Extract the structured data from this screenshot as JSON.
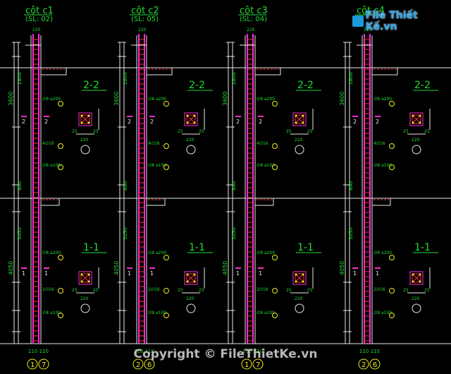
{
  "columns": [
    {
      "name": "cột c1",
      "sl": "(SL: 02)",
      "axis": "1",
      "axis_b": "7",
      "bottom_dims": "110 110"
    },
    {
      "name": "cột c2",
      "sl": "(SL: 05)",
      "axis": "2",
      "axis_b": "6",
      "bottom_dims": "110 110"
    },
    {
      "name": "cột c3",
      "sl": "(SL: 04)",
      "axis": "1",
      "axis_b": "7",
      "bottom_dims": "110 110"
    },
    {
      "name": "cột c4",
      "sl": "",
      "axis": "2",
      "axis_b": "6",
      "bottom_dims": "110 110"
    }
  ],
  "sections": {
    "upper": "2-2",
    "lower": "1-1"
  },
  "dims": {
    "d1": "3600",
    "d2": "4050",
    "d3": "800",
    "d4": "220",
    "d5": "25"
  },
  "rebar_notes": {
    "a": "4∅16",
    "b": "2∅16",
    "c": "∅8 a200",
    "d": "∅8 a100"
  },
  "logo": {
    "text": "File Thiết Kế.vn"
  },
  "copyright": "Copyright © FileThietKe.vn"
}
